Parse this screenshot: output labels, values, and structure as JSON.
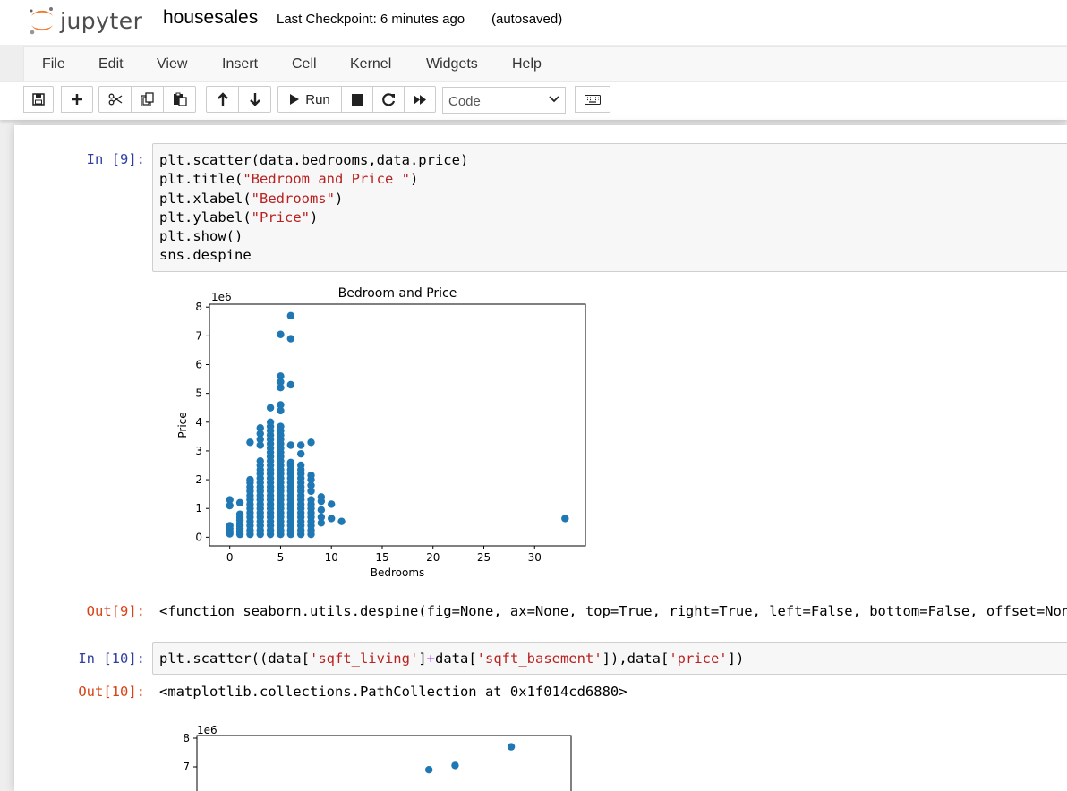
{
  "header": {
    "logo_text": "jupyter",
    "notebook_name": "housesales",
    "checkpoint": "Last Checkpoint: 6 minutes ago",
    "autosave_status": "(autosaved)"
  },
  "menu": {
    "items": [
      "File",
      "Edit",
      "View",
      "Insert",
      "Cell",
      "Kernel",
      "Widgets",
      "Help"
    ]
  },
  "toolbar": {
    "run_label": "Run",
    "cell_type": "Code",
    "icons": [
      "save-icon",
      "plus-icon",
      "cut-icon",
      "copy-icon",
      "paste-icon",
      "arrow-up-icon",
      "arrow-down-icon",
      "run-icon",
      "stop-icon",
      "restart-icon",
      "fast-forward-icon",
      "chevron-down-icon",
      "keyboard-icon"
    ]
  },
  "cells": {
    "c9": {
      "in_prompt": "In [9]:",
      "out_prompt": "Out[9]:",
      "code": {
        "l1": "plt.scatter(data.bedrooms,data.price)",
        "l2a": "plt.title(",
        "l2b": "\"Bedroom and Price \"",
        "l2c": ")",
        "l3a": "plt.xlabel(",
        "l3b": "\"Bedrooms\"",
        "l3c": ")",
        "l4a": "plt.ylabel(",
        "l4b": "\"Price\"",
        "l4c": ")",
        "l5": "plt.show()",
        "l6": "sns.despine"
      },
      "output": "<function seaborn.utils.despine(fig=None, ax=None, top=True, right=True, left=False, bottom=False, offset=None, trim=False)>"
    },
    "c10": {
      "in_prompt": "In [10]:",
      "out_prompt": "Out[10]:",
      "code": {
        "a": "plt.scatter((data[",
        "b": "'sqft_living'",
        "c": "]",
        "d": "+",
        "e": "data[",
        "f": "'sqft_basement'",
        "g": "]),data[",
        "h": "'price'",
        "i": "])"
      },
      "output": "<matplotlib.collections.PathCollection at 0x1f014cd6880>"
    }
  },
  "chart_data": [
    {
      "type": "scatter",
      "title": "Bedroom and Price",
      "xlabel": "Bedrooms",
      "ylabel": "Price",
      "y_offset_label": "1e6",
      "xlim": [
        -2,
        35
      ],
      "ylim": [
        -0.3,
        8.1
      ],
      "xticks": [
        0,
        5,
        10,
        15,
        20,
        25,
        30
      ],
      "yticks": [
        0,
        1,
        2,
        3,
        4,
        5,
        6,
        7,
        8
      ],
      "color": "#1f77b4",
      "points": [
        {
          "x": 0,
          "y": 0.12
        },
        {
          "x": 0,
          "y": 0.2
        },
        {
          "x": 0,
          "y": 0.3
        },
        {
          "x": 0,
          "y": 0.4
        },
        {
          "x": 0,
          "y": 1.1
        },
        {
          "x": 0,
          "y": 1.3
        },
        {
          "x": 1,
          "y": 0.1
        },
        {
          "x": 1,
          "y": 0.2
        },
        {
          "x": 1,
          "y": 0.3
        },
        {
          "x": 1,
          "y": 0.4
        },
        {
          "x": 1,
          "y": 0.5
        },
        {
          "x": 1,
          "y": 0.6
        },
        {
          "x": 1,
          "y": 0.7
        },
        {
          "x": 1,
          "y": 0.8
        },
        {
          "x": 1,
          "y": 1.2
        },
        {
          "x": 2,
          "y": 0.1
        },
        {
          "x": 2,
          "y": 0.25
        },
        {
          "x": 2,
          "y": 0.4
        },
        {
          "x": 2,
          "y": 0.55
        },
        {
          "x": 2,
          "y": 0.7
        },
        {
          "x": 2,
          "y": 0.85
        },
        {
          "x": 2,
          "y": 1.0
        },
        {
          "x": 2,
          "y": 1.15
        },
        {
          "x": 2,
          "y": 1.3
        },
        {
          "x": 2,
          "y": 1.45
        },
        {
          "x": 2,
          "y": 1.6
        },
        {
          "x": 2,
          "y": 1.75
        },
        {
          "x": 2,
          "y": 1.9
        },
        {
          "x": 2,
          "y": 2.0
        },
        {
          "x": 2,
          "y": 3.3
        },
        {
          "x": 3,
          "y": 0.1
        },
        {
          "x": 3,
          "y": 0.25
        },
        {
          "x": 3,
          "y": 0.4
        },
        {
          "x": 3,
          "y": 0.55
        },
        {
          "x": 3,
          "y": 0.7
        },
        {
          "x": 3,
          "y": 0.85
        },
        {
          "x": 3,
          "y": 1.0
        },
        {
          "x": 3,
          "y": 1.15
        },
        {
          "x": 3,
          "y": 1.3
        },
        {
          "x": 3,
          "y": 1.45
        },
        {
          "x": 3,
          "y": 1.6
        },
        {
          "x": 3,
          "y": 1.75
        },
        {
          "x": 3,
          "y": 1.9
        },
        {
          "x": 3,
          "y": 2.05
        },
        {
          "x": 3,
          "y": 2.2
        },
        {
          "x": 3,
          "y": 2.35
        },
        {
          "x": 3,
          "y": 2.5
        },
        {
          "x": 3,
          "y": 2.65
        },
        {
          "x": 3,
          "y": 3.2
        },
        {
          "x": 3,
          "y": 3.4
        },
        {
          "x": 3,
          "y": 3.6
        },
        {
          "x": 3,
          "y": 3.8
        },
        {
          "x": 4,
          "y": 0.1
        },
        {
          "x": 4,
          "y": 0.25
        },
        {
          "x": 4,
          "y": 0.4
        },
        {
          "x": 4,
          "y": 0.55
        },
        {
          "x": 4,
          "y": 0.7
        },
        {
          "x": 4,
          "y": 0.85
        },
        {
          "x": 4,
          "y": 1.0
        },
        {
          "x": 4,
          "y": 1.15
        },
        {
          "x": 4,
          "y": 1.3
        },
        {
          "x": 4,
          "y": 1.45
        },
        {
          "x": 4,
          "y": 1.6
        },
        {
          "x": 4,
          "y": 1.75
        },
        {
          "x": 4,
          "y": 1.9
        },
        {
          "x": 4,
          "y": 2.05
        },
        {
          "x": 4,
          "y": 2.2
        },
        {
          "x": 4,
          "y": 2.35
        },
        {
          "x": 4,
          "y": 2.5
        },
        {
          "x": 4,
          "y": 2.65
        },
        {
          "x": 4,
          "y": 2.8
        },
        {
          "x": 4,
          "y": 2.95
        },
        {
          "x": 4,
          "y": 3.1
        },
        {
          "x": 4,
          "y": 3.25
        },
        {
          "x": 4,
          "y": 3.4
        },
        {
          "x": 4,
          "y": 3.55
        },
        {
          "x": 4,
          "y": 3.7
        },
        {
          "x": 4,
          "y": 3.85
        },
        {
          "x": 4,
          "y": 4.0
        },
        {
          "x": 4,
          "y": 4.5
        },
        {
          "x": 5,
          "y": 0.1
        },
        {
          "x": 5,
          "y": 0.25
        },
        {
          "x": 5,
          "y": 0.4
        },
        {
          "x": 5,
          "y": 0.55
        },
        {
          "x": 5,
          "y": 0.7
        },
        {
          "x": 5,
          "y": 0.85
        },
        {
          "x": 5,
          "y": 1.0
        },
        {
          "x": 5,
          "y": 1.15
        },
        {
          "x": 5,
          "y": 1.3
        },
        {
          "x": 5,
          "y": 1.45
        },
        {
          "x": 5,
          "y": 1.6
        },
        {
          "x": 5,
          "y": 1.75
        },
        {
          "x": 5,
          "y": 1.9
        },
        {
          "x": 5,
          "y": 2.05
        },
        {
          "x": 5,
          "y": 2.2
        },
        {
          "x": 5,
          "y": 2.35
        },
        {
          "x": 5,
          "y": 2.5
        },
        {
          "x": 5,
          "y": 2.65
        },
        {
          "x": 5,
          "y": 2.8
        },
        {
          "x": 5,
          "y": 2.95
        },
        {
          "x": 5,
          "y": 3.1
        },
        {
          "x": 5,
          "y": 3.25
        },
        {
          "x": 5,
          "y": 3.4
        },
        {
          "x": 5,
          "y": 3.55
        },
        {
          "x": 5,
          "y": 3.7
        },
        {
          "x": 5,
          "y": 3.85
        },
        {
          "x": 5,
          "y": 4.4
        },
        {
          "x": 5,
          "y": 4.6
        },
        {
          "x": 5,
          "y": 5.2
        },
        {
          "x": 5,
          "y": 5.4
        },
        {
          "x": 5,
          "y": 5.6
        },
        {
          "x": 5,
          "y": 7.05
        },
        {
          "x": 6,
          "y": 0.1
        },
        {
          "x": 6,
          "y": 0.25
        },
        {
          "x": 6,
          "y": 0.4
        },
        {
          "x": 6,
          "y": 0.55
        },
        {
          "x": 6,
          "y": 0.7
        },
        {
          "x": 6,
          "y": 0.85
        },
        {
          "x": 6,
          "y": 1.0
        },
        {
          "x": 6,
          "y": 1.15
        },
        {
          "x": 6,
          "y": 1.3
        },
        {
          "x": 6,
          "y": 1.45
        },
        {
          "x": 6,
          "y": 1.6
        },
        {
          "x": 6,
          "y": 1.75
        },
        {
          "x": 6,
          "y": 1.9
        },
        {
          "x": 6,
          "y": 2.05
        },
        {
          "x": 6,
          "y": 2.2
        },
        {
          "x": 6,
          "y": 2.35
        },
        {
          "x": 6,
          "y": 2.5
        },
        {
          "x": 6,
          "y": 2.6
        },
        {
          "x": 6,
          "y": 3.2
        },
        {
          "x": 6,
          "y": 5.3
        },
        {
          "x": 6,
          "y": 6.9
        },
        {
          "x": 6,
          "y": 7.7
        },
        {
          "x": 7,
          "y": 0.1
        },
        {
          "x": 7,
          "y": 0.25
        },
        {
          "x": 7,
          "y": 0.4
        },
        {
          "x": 7,
          "y": 0.55
        },
        {
          "x": 7,
          "y": 0.7
        },
        {
          "x": 7,
          "y": 0.85
        },
        {
          "x": 7,
          "y": 1.0
        },
        {
          "x": 7,
          "y": 1.15
        },
        {
          "x": 7,
          "y": 1.3
        },
        {
          "x": 7,
          "y": 1.45
        },
        {
          "x": 7,
          "y": 1.6
        },
        {
          "x": 7,
          "y": 1.75
        },
        {
          "x": 7,
          "y": 1.9
        },
        {
          "x": 7,
          "y": 2.05
        },
        {
          "x": 7,
          "y": 2.2
        },
        {
          "x": 7,
          "y": 2.35
        },
        {
          "x": 7,
          "y": 2.5
        },
        {
          "x": 7,
          "y": 2.9
        },
        {
          "x": 7,
          "y": 3.2
        },
        {
          "x": 8,
          "y": 0.1
        },
        {
          "x": 8,
          "y": 0.25
        },
        {
          "x": 8,
          "y": 0.4
        },
        {
          "x": 8,
          "y": 0.55
        },
        {
          "x": 8,
          "y": 0.7
        },
        {
          "x": 8,
          "y": 0.85
        },
        {
          "x": 8,
          "y": 1.0
        },
        {
          "x": 8,
          "y": 1.15
        },
        {
          "x": 8,
          "y": 1.3
        },
        {
          "x": 8,
          "y": 1.6
        },
        {
          "x": 8,
          "y": 1.8
        },
        {
          "x": 8,
          "y": 2.0
        },
        {
          "x": 8,
          "y": 2.15
        },
        {
          "x": 8,
          "y": 3.3
        },
        {
          "x": 9,
          "y": 0.5
        },
        {
          "x": 9,
          "y": 0.7
        },
        {
          "x": 9,
          "y": 0.95
        },
        {
          "x": 9,
          "y": 1.25
        },
        {
          "x": 9,
          "y": 1.4
        },
        {
          "x": 10,
          "y": 0.65
        },
        {
          "x": 10,
          "y": 1.15
        },
        {
          "x": 11,
          "y": 0.55
        },
        {
          "x": 33,
          "y": 0.65
        }
      ]
    },
    {
      "type": "scatter",
      "y_offset_label": "1e6",
      "yticks": [
        7,
        8
      ],
      "color": "#1f77b4",
      "points": [
        {
          "x": 0.62,
          "y": 6.9
        },
        {
          "x": 0.69,
          "y": 7.05
        },
        {
          "x": 0.84,
          "y": 7.7
        }
      ]
    }
  ]
}
